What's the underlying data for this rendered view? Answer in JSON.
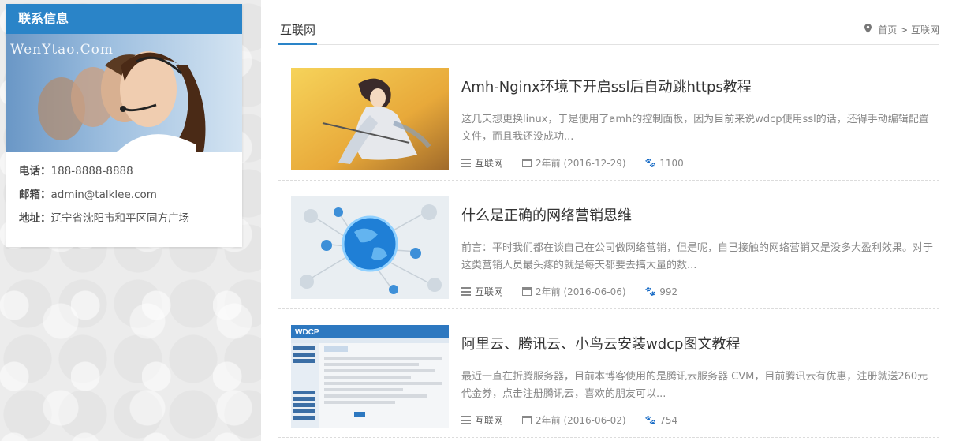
{
  "sidebar": {
    "title": "联系信息",
    "watermark": "WenYtao.Com",
    "phone_label": "电话：",
    "phone": "188-8888-8888",
    "email_label": "邮箱：",
    "email": "admin@talklee.com",
    "address_label": "地址：",
    "address": "辽宁省沈阳市和平区同方广场"
  },
  "main": {
    "tab_title": "互联网",
    "breadcrumb": {
      "home": "首页",
      "sep": ">",
      "current": "互联网"
    },
    "articles": [
      {
        "title": "Amh-Nginx环境下开启ssl后自动跳https教程",
        "summary": "这几天想更换linux，于是使用了amh的控制面板，因为目前来说wdcp使用ssl的话，还得手动编辑配置文件，而且我还没成功...",
        "category": "互联网",
        "date": "2年前 (2016-12-29)",
        "views": "1100"
      },
      {
        "title": "什么是正确的网络营销思维",
        "summary": "前言：平时我们都在谈自己在公司做网络营销，但是呢，自己接触的网络营销又是没多大盈利效果。对于这类营销人员最头疼的就是每天都要去搞大量的数...",
        "category": "互联网",
        "date": "2年前 (2016-06-06)",
        "views": "992"
      },
      {
        "title": "阿里云、腾讯云、小鸟云安装wdcp图文教程",
        "summary": "最近一直在折腾服务器，目前本博客使用的是腾讯云服务器 CVM，目前腾讯云有优惠，注册就送260元代金券，点击注册腾讯云，喜欢的朋友可以...",
        "category": "互联网",
        "date": "2年前 (2016-06-02)",
        "views": "754"
      }
    ],
    "wdcp_banner": "WDCP"
  },
  "icons": [
    "map-pin-icon",
    "list-icon",
    "calendar-icon",
    "paw-icon"
  ]
}
